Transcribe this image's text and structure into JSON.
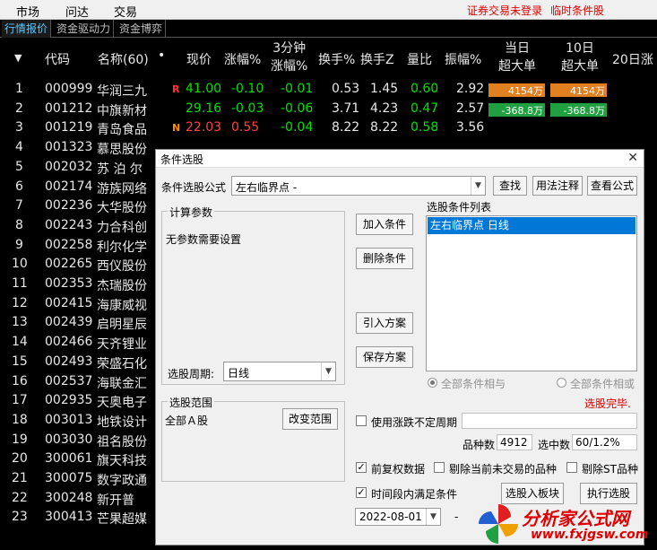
{
  "menubar": {
    "items": [
      "市场",
      "问达",
      "交易"
    ],
    "status_not_logged": "证券交易未登录",
    "temp_condition": "临时条件股"
  },
  "tabs": [
    "行情报价",
    "资金驱动力",
    "资金博弈"
  ],
  "header": {
    "code": "代码",
    "name": "名称(60)",
    "dot": "•",
    "price": "现价",
    "change_pct": "涨幅%",
    "change_3min_l1": "3分钟",
    "change_3min_l2": "涨幅%",
    "turnover": "换手%",
    "turnover_z": "换手Z",
    "volume_ratio": "量比",
    "amplitude": "振幅%",
    "day_big_l1": "当日",
    "day_big_l2": "超大单",
    "ten_day_l1": "10日",
    "ten_day_l2": "超大单",
    "twenty_day": "20日涨"
  },
  "rows": [
    {
      "idx": "1",
      "code": "000999",
      "name": "华润三九",
      "flag": "R",
      "price": "41.00",
      "chg": "-0.10",
      "chg3": "-0.01",
      "turn": "0.53",
      "turnz": "1.45",
      "vr": "0.60",
      "amp": "2.92",
      "big1": "4154万",
      "big10": "4154万",
      "c_price": "green",
      "c_chg": "green",
      "c_chg3": "green",
      "c_vr": "green",
      "bar": "orange"
    },
    {
      "idx": "2",
      "code": "001212",
      "name": "中旗新材",
      "flag": "",
      "price": "29.16",
      "chg": "-0.03",
      "chg3": "-0.06",
      "turn": "3.71",
      "turnz": "4.23",
      "vr": "0.47",
      "amp": "2.57",
      "big1": "-368.8万",
      "big10": "-368.8万",
      "c_price": "green",
      "c_chg": "green",
      "c_chg3": "green",
      "c_vr": "green",
      "bar": "greenbar"
    },
    {
      "idx": "3",
      "code": "001219",
      "name": "青岛食品",
      "flag": "N",
      "price": "22.03",
      "chg": "0.55",
      "chg3": "-0.04",
      "turn": "8.22",
      "turnz": "8.22",
      "vr": "0.58",
      "amp": "3.56",
      "big1": "",
      "big10": "",
      "c_price": "red",
      "c_chg": "red",
      "c_chg3": "green",
      "c_vr": "green",
      "bar": ""
    },
    {
      "idx": "4",
      "code": "001323",
      "name": "慕思股份"
    },
    {
      "idx": "5",
      "code": "002032",
      "name": "苏 泊 尔"
    },
    {
      "idx": "6",
      "code": "002174",
      "name": "游族网络"
    },
    {
      "idx": "7",
      "code": "002236",
      "name": "大华股份"
    },
    {
      "idx": "8",
      "code": "002243",
      "name": "力合科创"
    },
    {
      "idx": "9",
      "code": "002258",
      "name": "利尔化学"
    },
    {
      "idx": "10",
      "code": "002265",
      "name": "西仪股份"
    },
    {
      "idx": "11",
      "code": "002353",
      "name": "杰瑞股份"
    },
    {
      "idx": "12",
      "code": "002415",
      "name": "海康威视"
    },
    {
      "idx": "13",
      "code": "002439",
      "name": "启明星辰"
    },
    {
      "idx": "14",
      "code": "002466",
      "name": "天齐锂业"
    },
    {
      "idx": "15",
      "code": "002493",
      "name": "荣盛石化"
    },
    {
      "idx": "16",
      "code": "002537",
      "name": "海联金汇"
    },
    {
      "idx": "17",
      "code": "002935",
      "name": "天奥电子"
    },
    {
      "idx": "18",
      "code": "003013",
      "name": "地铁设计"
    },
    {
      "idx": "19",
      "code": "003030",
      "name": "祖名股份"
    },
    {
      "idx": "20",
      "code": "300061",
      "name": "旗天科技"
    },
    {
      "idx": "21",
      "code": "300075",
      "name": "数字政通"
    },
    {
      "idx": "22",
      "code": "300248",
      "name": "新开普"
    },
    {
      "idx": "23",
      "code": "300413",
      "name": "芒果超媒"
    }
  ],
  "dialog": {
    "title": "条件选股",
    "close": "✕",
    "formula_label": "条件选股公式",
    "formula_value": "左右临界点  -",
    "btn_find": "查找",
    "btn_usage": "用法注释",
    "btn_view": "查看公式",
    "calc_params_title": "计算参数",
    "no_params": "无参数需要设置",
    "period_label": "选股周期:",
    "period_value": "日线",
    "btn_add": "加入条件",
    "btn_delete": "删除条件",
    "btn_import": "引入方案",
    "btn_save": "保存方案",
    "cond_list_title": "选股条件列表",
    "cond_item": "左右临界点  日线",
    "radio_and": "全部条件相与",
    "radio_or": "全部条件相或",
    "done": "选股完毕.",
    "range_title": "选股范围",
    "range_value": "全部Ａ股",
    "btn_change_range": "改变范围",
    "chk_uncertain": "使用涨跌不定周期",
    "count_label": "品种数",
    "count_value": "4912",
    "selected_label": "选中数",
    "selected_value": "60/1.2%",
    "chk_fq": "前复权数据",
    "chk_exclude_no_trade": "剔除当前未交易的品种",
    "chk_exclude_st": "剔除ST品种",
    "chk_time_range": "时间段内满足条件",
    "btn_to_block": "选股入板块",
    "btn_execute": "执行选股",
    "date_value": "2022-08-01",
    "date_dash": "-"
  },
  "logo": {
    "text": "分析家公式网",
    "url": "www.fxjgsw.com"
  }
}
